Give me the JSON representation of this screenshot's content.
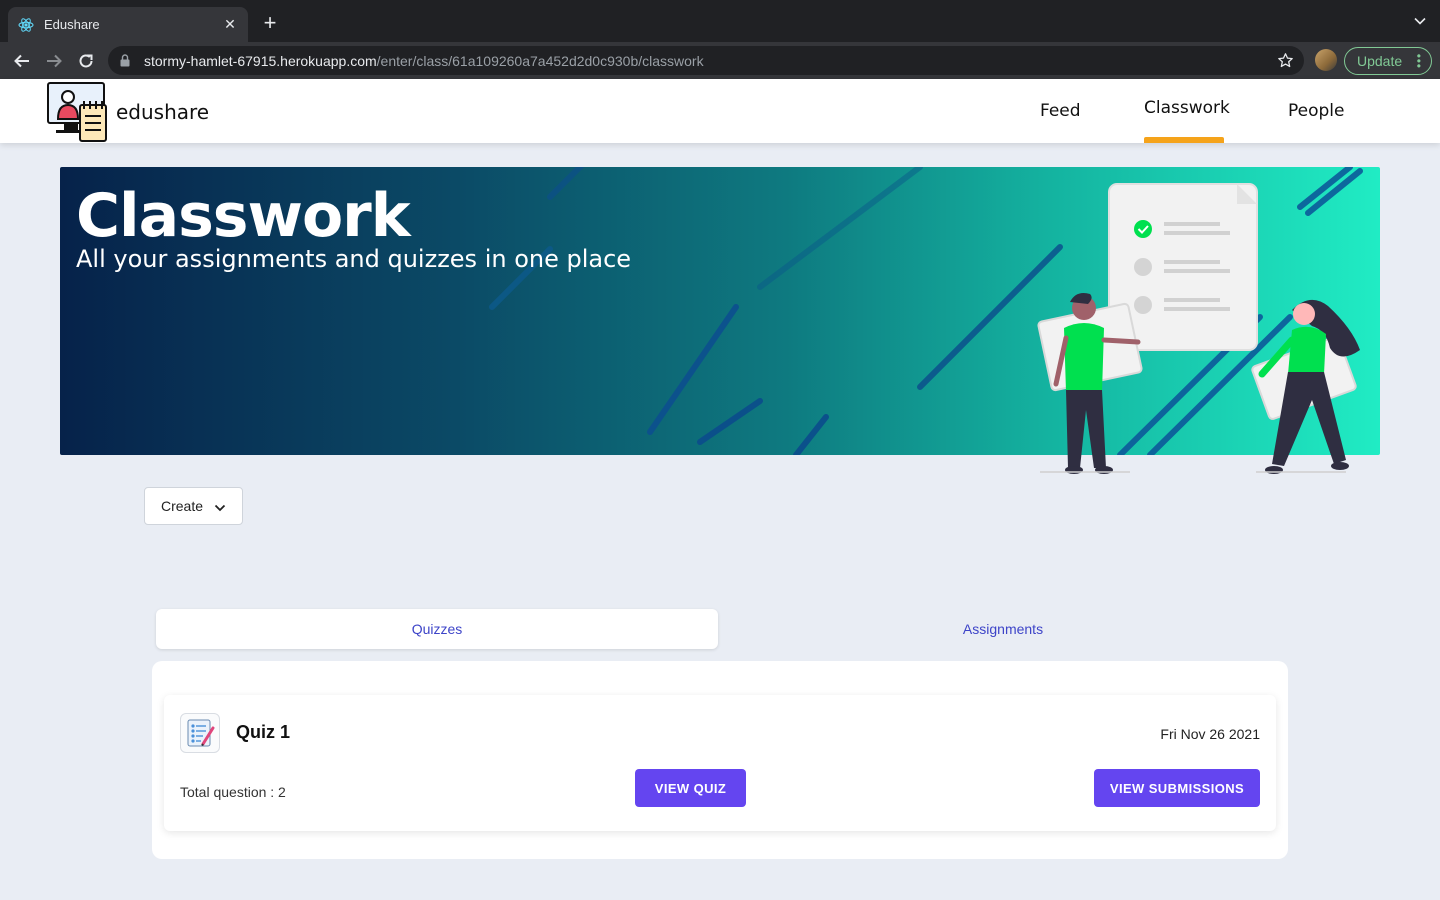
{
  "browser": {
    "tab_title": "Edushare",
    "tab_close": "✕",
    "new_tab": "+",
    "url_host": "stormy-hamlet-67915.herokuapp.com",
    "url_path": "/enter/class/61a109260a7a452d2d0c930b/classwork",
    "update_label": "Update",
    "update_menu": "⋮"
  },
  "navbar": {
    "brand": "edushare",
    "links": [
      "Feed",
      "Classwork",
      "People"
    ],
    "active": "Classwork",
    "accent_color": "#f5a31a"
  },
  "banner": {
    "title": "Classwork",
    "subtitle": "All your assignments and quizzes in one place"
  },
  "create": {
    "label": "Create"
  },
  "tabs": {
    "quizzes": "Quizzes",
    "assignments": "Assignments",
    "selected": "Quizzes"
  },
  "quiz": {
    "title": "Quiz 1",
    "date": "Fri Nov 26 2021",
    "total": "Total question : 2",
    "view_quiz": "VIEW QUIZ",
    "view_submissions": "VIEW SUBMISSIONS",
    "button_color": "#6445f0"
  }
}
